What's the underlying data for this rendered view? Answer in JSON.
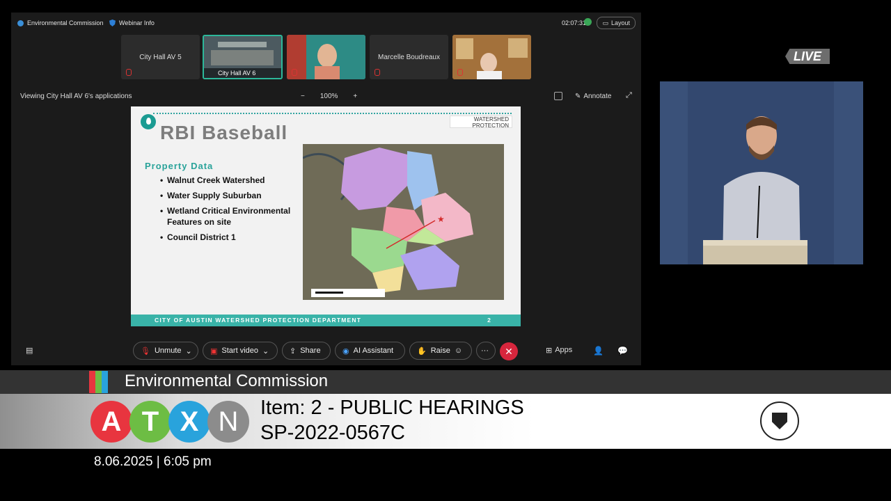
{
  "webex": {
    "meeting_title": "Environmental Commission",
    "webinar_info": "Webinar Info",
    "elapsed_time": "02:07:31",
    "layout_button": "Layout",
    "participants": [
      {
        "name": "City Hall AV 5",
        "muted": true
      },
      {
        "name": "City Hall AV 6",
        "muted": true,
        "active": true
      },
      {
        "name": "",
        "muted": true
      },
      {
        "name": "Marcelle Boudreaux",
        "muted": true
      },
      {
        "name": "",
        "muted": true
      }
    ],
    "viewing_text": "Viewing City Hall AV 6's applications",
    "zoom_level": "100%",
    "zoom_out": "−",
    "zoom_in": "+",
    "annotate_button": "Annotate",
    "controls": {
      "unmute": "Unmute",
      "start_video": "Start video",
      "share": "Share",
      "ai_assistant": "AI Assistant",
      "raise": "Raise",
      "more": "···",
      "end": "✕",
      "apps": "Apps"
    }
  },
  "slide": {
    "title": "RBI Baseball",
    "logo_text": "WATERSHED PROTECTION",
    "section_heading": "Property Data",
    "bullets": [
      "Walnut Creek Watershed",
      "Water Supply Suburban",
      "Wetland Critical Environmental Features on site",
      "Council District 1"
    ],
    "footer": "CITY OF AUSTIN WATERSHED PROTECTION DEPARTMENT",
    "page_number": "2"
  },
  "broadcast": {
    "live_badge": "LIVE",
    "commission": "Environmental Commission",
    "atxn_letters": [
      "A",
      "T",
      "X",
      "N"
    ],
    "atxn_colors": [
      "#e8353f",
      "#6dbd44",
      "#29a3dc",
      "#8c8c8c"
    ],
    "color_stripes": [
      "#e8353f",
      "#6dbd44",
      "#29a3dc"
    ],
    "item_line1": "Item: 2 - PUBLIC HEARINGS",
    "item_line2": "SP-2022-0567C",
    "datetime": "8.06.2025 | 6:05 pm"
  }
}
